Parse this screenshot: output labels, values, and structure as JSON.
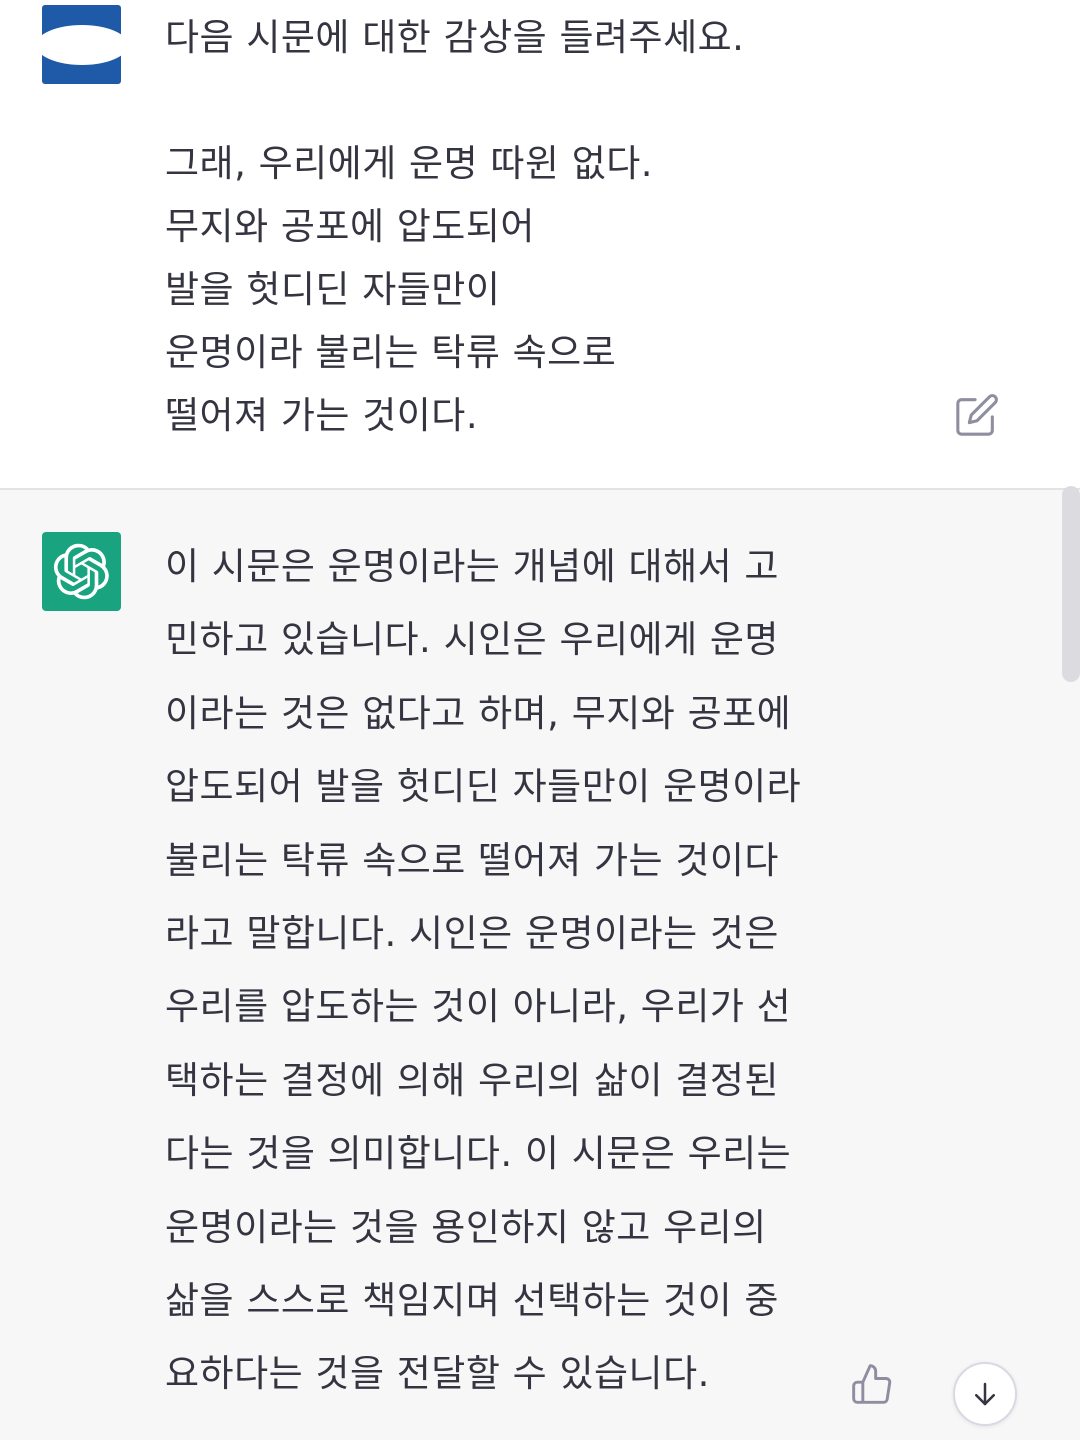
{
  "user_message": {
    "lines": [
      "다음 시문에 대한 감상을 들려주세요.",
      "",
      "그래, 우리에게 운명 따윈 없다.",
      "무지와 공포에 압도되어",
      "발을 헛디딘 자들만이",
      "운명이라 불리는 탁류 속으로",
      "떨어져 가는 것이다."
    ],
    "avatar_icon": "user-avatar-icon",
    "edit_icon": "edit-icon"
  },
  "assistant_message": {
    "lines": [
      "이 시문은 운명이라는 개념에 대해서 고",
      "민하고 있습니다. 시인은 우리에게 운명",
      "이라는 것은 없다고 하며, 무지와 공포에",
      "압도되어 발을 헛디딘 자들만이 운명이라",
      "불리는 탁류 속으로 떨어져 가는 것이다",
      "라고 말합니다. 시인은 운명이라는 것은",
      "우리를 압도하는 것이 아니라, 우리가 선",
      "택하는 결정에 의해 우리의 삶이 결정된",
      "다는 것을 의미합니다. 이 시문은 우리는",
      "운명이라는 것을 용인하지 않고 우리의",
      "삶을 스스로 책임지며 선택하는 것이 중",
      "요하다는 것을 전달할 수 있습니다."
    ],
    "avatar_icon": "openai-logo-icon",
    "feedback_icon": "thumbs-up-icon",
    "scroll_icon": "arrow-down-icon"
  },
  "colors": {
    "user_bg": "#ffffff",
    "assistant_bg": "#f7f7f8",
    "gpt_avatar": "#19a37f",
    "user_avatar": "#1e5aa8",
    "text": "#343541",
    "icon": "#8e8ea0"
  }
}
